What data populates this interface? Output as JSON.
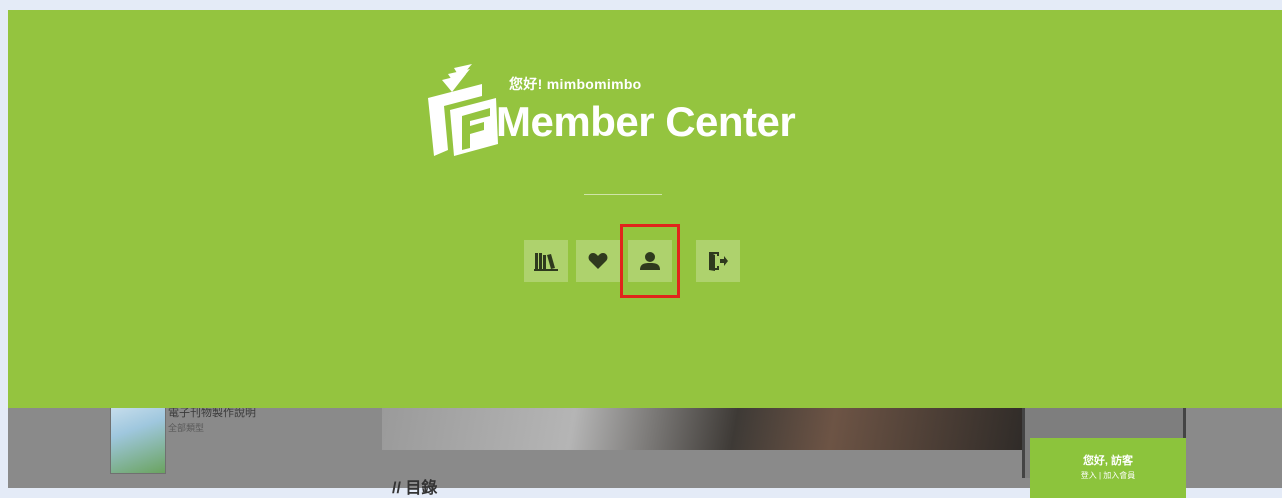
{
  "background": {
    "item_title": "電子刊物製作說明",
    "item_subtitle": "全部類型",
    "section_heading": "// 目錄",
    "guest_greeting": "您好, 訪客",
    "guest_links": "登入 | 加入會員"
  },
  "member_center": {
    "greeting": "您好! mimbomimbo",
    "title": "Member Center"
  },
  "nav_icons": [
    {
      "name": "bookshelf-icon",
      "label": "bookshelf",
      "selected": false
    },
    {
      "name": "heart-icon",
      "label": "favorites",
      "selected": false
    },
    {
      "name": "user-icon",
      "label": "profile",
      "selected": true
    },
    {
      "name": "logout-icon",
      "label": "logout",
      "selected": false
    }
  ],
  "colors": {
    "overlay_green": "#94c43f",
    "button_green": "#aed26d",
    "highlight_red": "#e0251b",
    "icon_dark": "#2f3a1e"
  }
}
